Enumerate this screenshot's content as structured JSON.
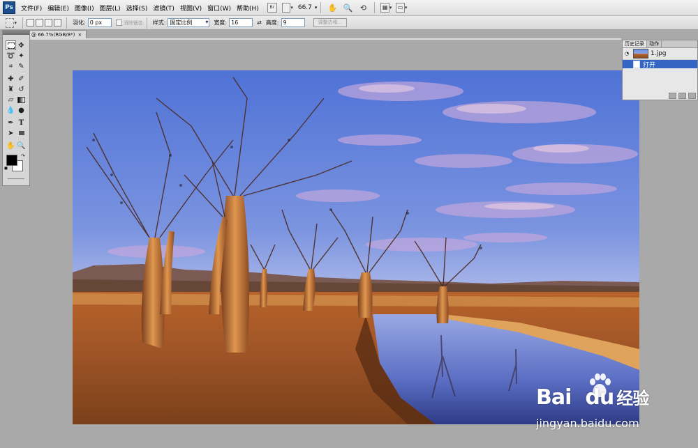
{
  "app": {
    "logo": "Ps",
    "menus": [
      "文件(F)",
      "编辑(E)",
      "图像(I)",
      "图层(L)",
      "选择(S)",
      "滤镜(T)",
      "视图(V)",
      "窗口(W)",
      "帮助(H)"
    ],
    "zoom": "66.7",
    "toolbar_icons": [
      "bridge-icon",
      "screen-mode-icon",
      "zoom-dropdown",
      "hand-icon",
      "zoom-icon",
      "rotate-view-icon",
      "arrange-docs-icon",
      "screen-mode-dropdown-icon"
    ]
  },
  "options": {
    "feather_label": "羽化:",
    "feather_value": "0 px",
    "antialias_label": "消除锯齿",
    "style_label": "样式:",
    "style_value": "固定比例",
    "width_label": "宽度:",
    "width_value": "16",
    "height_label": "高度:",
    "height_value": "9",
    "refine_edge": "调整边缘..."
  },
  "document": {
    "tab_title": "@ 66.7%(RGB/8*)",
    "close": "×"
  },
  "history": {
    "tabs": [
      "历史记录",
      "动作"
    ],
    "snapshot": "1.jpg",
    "state": "打开"
  },
  "watermark": {
    "brand": "Bai",
    "brand_tail": "du",
    "cn": "经验",
    "url": "jingyan.baidu.com"
  },
  "colors": {
    "selection": "#3465c4",
    "panel": "#d6d6d6"
  }
}
